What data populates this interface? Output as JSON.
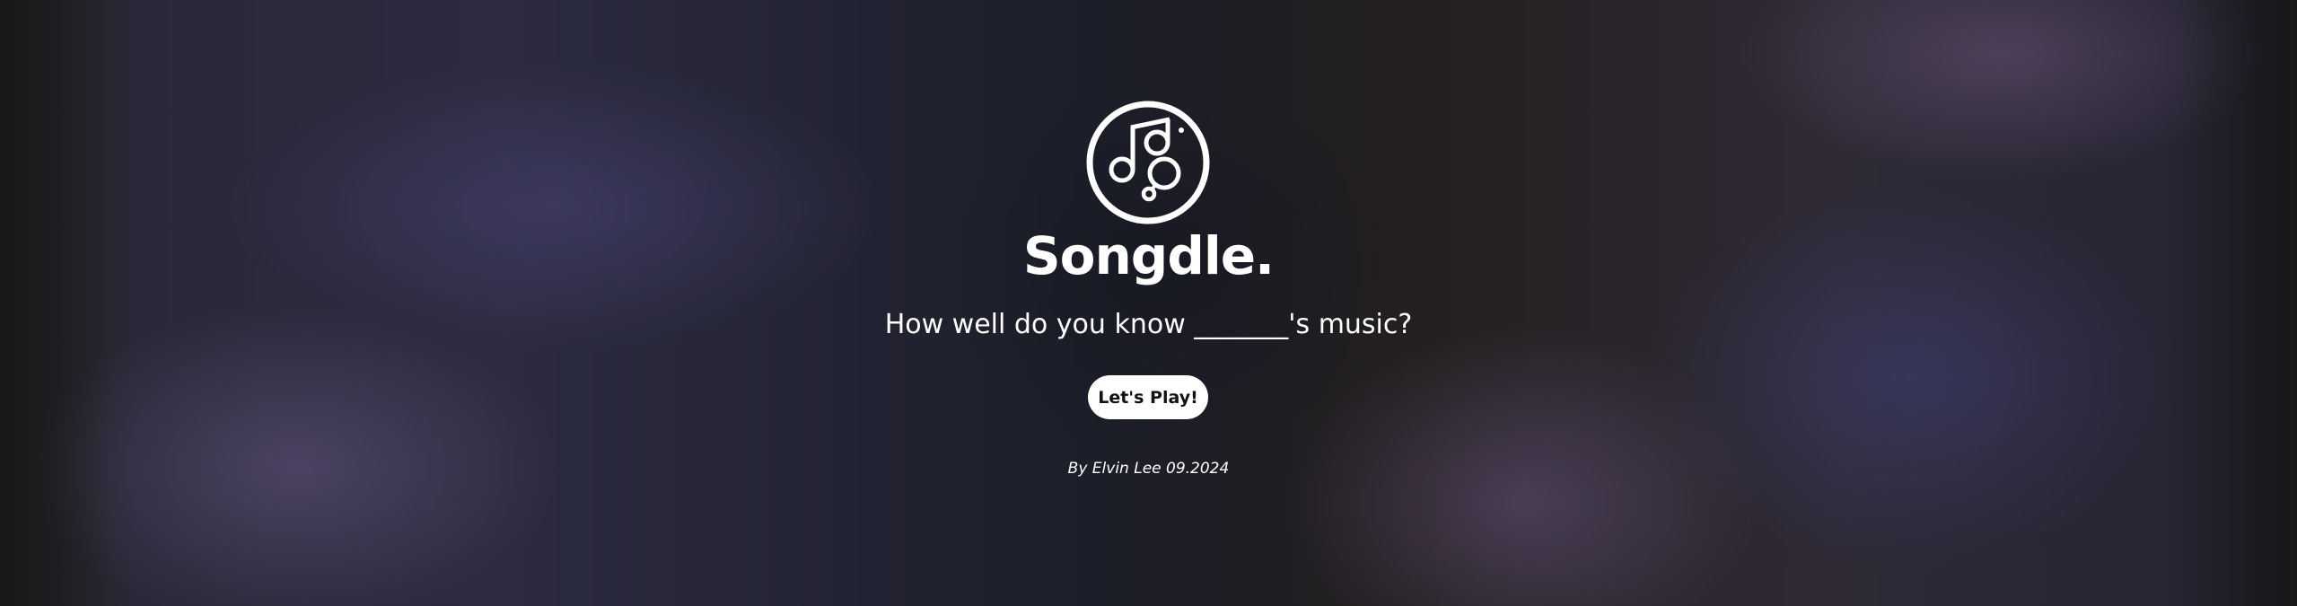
{
  "app": {
    "title": "Songdle.",
    "tagline": "How well do you know _______'s music?",
    "play_button_label": "Let's Play!",
    "credit": "By Elvin Lee 09.2024"
  },
  "icons": {
    "logo": "music-note-icon"
  },
  "colors": {
    "text": "#ffffff",
    "button_background": "#ffffff",
    "button_text": "#111111"
  }
}
